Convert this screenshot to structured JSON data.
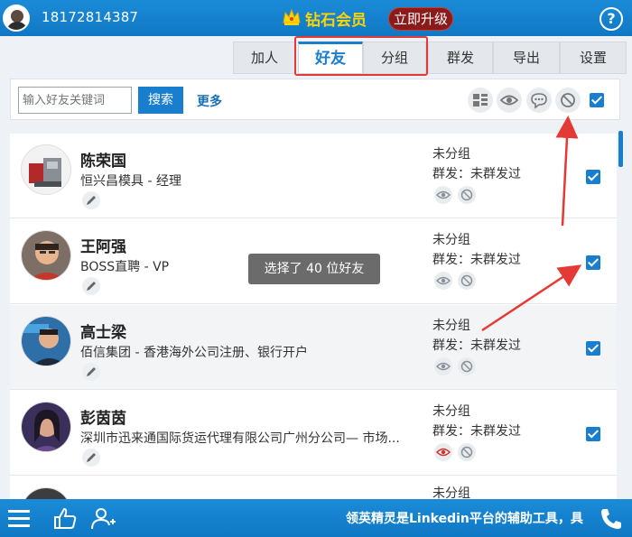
{
  "header": {
    "phone": "18172814387",
    "vip_label": "钻石会员",
    "upgrade_label": "立即升级",
    "help_label": "?"
  },
  "tabs": [
    {
      "label": "加人"
    },
    {
      "label": "好友"
    },
    {
      "label": "分组"
    },
    {
      "label": "群发"
    },
    {
      "label": "导出"
    },
    {
      "label": "设置"
    }
  ],
  "search": {
    "placeholder": "输入好友关键词",
    "button_label": "搜索",
    "more_label": "更多"
  },
  "toast": "选择了 40 位好友",
  "friends": [
    {
      "name": "陈荣国",
      "title": "恒兴昌模具 - 经理",
      "group": "未分组",
      "bulk": "群发：未群发过",
      "eye_color": "#8a9097"
    },
    {
      "name": "王阿强",
      "title": "BOSS直聘 - VP",
      "group": "未分组",
      "bulk": "群发：未群发过",
      "eye_color": "#8a9097"
    },
    {
      "name": "高士梁",
      "title": "佰信集团 - 香港海外公司注册、银行开户",
      "group": "未分组",
      "bulk": "群发：未群发过",
      "eye_color": "#8a9097"
    },
    {
      "name": "彭茵茵",
      "title": "深圳市迅来通国际货运代理有限公司广州分公司— 市场...",
      "group": "未分组",
      "bulk": "群发：未群发过",
      "eye_color": "#d32f2f"
    },
    {
      "name": "",
      "title": "",
      "group": "未分组",
      "bulk": "",
      "eye_color": "#8a9097"
    }
  ],
  "bottom": {
    "marquee": "领英精灵是Linkedin平台的辅助工具，具"
  },
  "colors": {
    "primary": "#1a7ecf",
    "vip_gold": "#ffd400",
    "upgrade_bg": "#8b1a1a",
    "annotation_red": "#e53935"
  }
}
